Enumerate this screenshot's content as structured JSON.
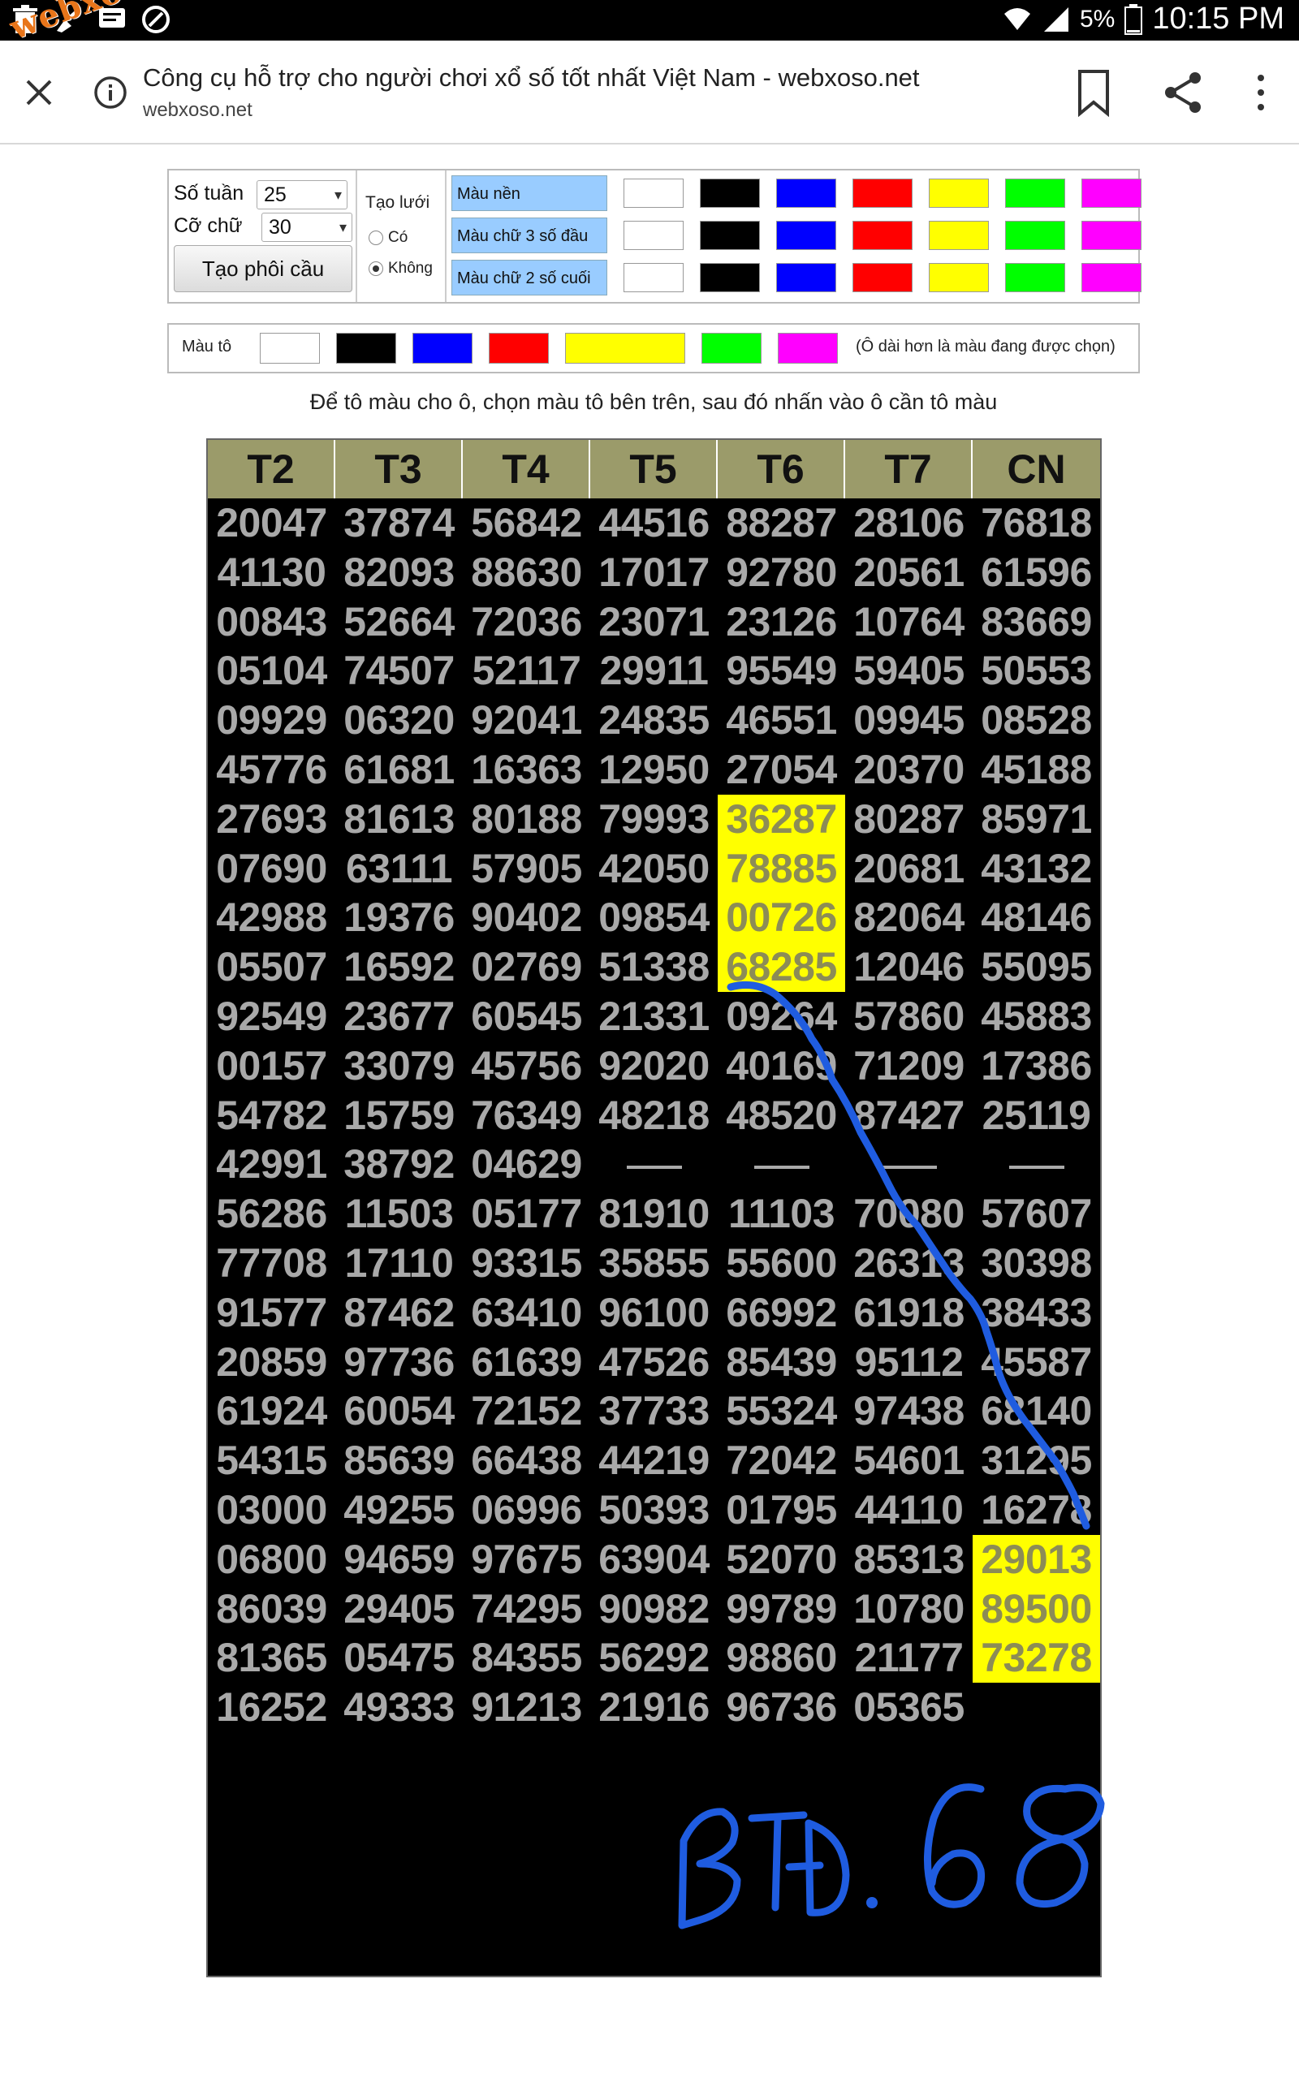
{
  "status_bar": {
    "battery": "5%",
    "time": "10:15 PM",
    "watermark": "webxoso.net"
  },
  "browser": {
    "page_title": "Công cụ hỗ trợ cho người chơi xổ số tốt nhất Việt Nam - webxoso.net",
    "url": "webxoso.net"
  },
  "controls": {
    "weeks_label": "Số tuần",
    "weeks_value": "25",
    "font_size_label": "Cỡ chữ",
    "font_size_value": "30",
    "generate_button": "Tạo phôi cầu",
    "grid_label": "Tạo lưới",
    "grid_options": [
      "Có",
      "Không"
    ],
    "grid_selected": "Không",
    "color_rows": [
      "Màu nền",
      "Màu chữ 3 số đầu",
      "Màu chữ 2 số cuối"
    ],
    "swatches": [
      "#ffffff",
      "#000000",
      "#0000ff",
      "#ff0000",
      "#ffff00",
      "#00ff00",
      "#ff00ff"
    ]
  },
  "paint": {
    "label": "Màu tô",
    "selected_color": "#ffff00",
    "note": "(Ô dài hơn là màu đang được chọn)"
  },
  "instruction": "Để tô màu cho ô, chọn màu tô bên trên, sau đó nhấn vào ô cần tô màu",
  "grid": {
    "headers": [
      "T2",
      "T3",
      "T4",
      "T5",
      "T6",
      "T7",
      "CN"
    ],
    "rows": [
      [
        "20047",
        "37874",
        "56842",
        "44516",
        "88287",
        "28106",
        "76818"
      ],
      [
        "41130",
        "82093",
        "88630",
        "17017",
        "92780",
        "20561",
        "61596"
      ],
      [
        "00843",
        "52664",
        "72036",
        "23071",
        "23126",
        "10764",
        "83669"
      ],
      [
        "05104",
        "74507",
        "52117",
        "29911",
        "95549",
        "59405",
        "50553"
      ],
      [
        "09929",
        "06320",
        "92041",
        "24835",
        "46551",
        "09945",
        "08528"
      ],
      [
        "45776",
        "61681",
        "16363",
        "12950",
        "27054",
        "20370",
        "45188"
      ],
      [
        "27693",
        "81613",
        "80188",
        "79993",
        "36287",
        "80287",
        "85971"
      ],
      [
        "07690",
        "63111",
        "57905",
        "42050",
        "78885",
        "20681",
        "43132"
      ],
      [
        "42988",
        "19376",
        "90402",
        "09854",
        "00726",
        "82064",
        "48146"
      ],
      [
        "05507",
        "16592",
        "02769",
        "51338",
        "68285",
        "12046",
        "55095"
      ],
      [
        "92549",
        "23677",
        "60545",
        "21331",
        "09264",
        "57860",
        "45883"
      ],
      [
        "00157",
        "33079",
        "45756",
        "92020",
        "40169",
        "71209",
        "17386"
      ],
      [
        "54782",
        "15759",
        "76349",
        "48218",
        "48520",
        "87427",
        "25119"
      ],
      [
        "42991",
        "38792",
        "04629",
        "",
        "",
        "",
        ""
      ],
      [
        "56286",
        "11503",
        "05177",
        "81910",
        "11103",
        "70080",
        "57607"
      ],
      [
        "77708",
        "17110",
        "93315",
        "35855",
        "55600",
        "26313",
        "30398"
      ],
      [
        "91577",
        "87462",
        "63410",
        "96100",
        "66992",
        "61918",
        "38433"
      ],
      [
        "20859",
        "97736",
        "61639",
        "47526",
        "85439",
        "95112",
        "45587"
      ],
      [
        "61924",
        "60054",
        "72152",
        "37733",
        "55324",
        "97438",
        "68140"
      ],
      [
        "54315",
        "85639",
        "66438",
        "44219",
        "72042",
        "54601",
        "31295"
      ],
      [
        "03000",
        "49255",
        "06996",
        "50393",
        "01795",
        "44110",
        "16278"
      ],
      [
        "06800",
        "94659",
        "97675",
        "63904",
        "52070",
        "85313",
        "29013"
      ],
      [
        "86039",
        "29405",
        "74295",
        "90982",
        "99789",
        "10780",
        "89500"
      ],
      [
        "81365",
        "05475",
        "84355",
        "56292",
        "98860",
        "21177",
        "73278"
      ],
      [
        "16252",
        "49333",
        "91213",
        "21916",
        "96736",
        "05365",
        ""
      ]
    ],
    "highlighted": [
      [
        6,
        4
      ],
      [
        7,
        4
      ],
      [
        8,
        4
      ],
      [
        9,
        4
      ],
      [
        21,
        6
      ],
      [
        22,
        6
      ],
      [
        23,
        6
      ]
    ],
    "blank_dash_cells": [
      [
        13,
        3
      ],
      [
        13,
        4
      ],
      [
        13,
        5
      ],
      [
        13,
        6
      ]
    ],
    "highlight_color": "#ffff00"
  },
  "annotation": {
    "handwriting": "BTĐ . 68",
    "ink_color": "#1f5ce0"
  }
}
